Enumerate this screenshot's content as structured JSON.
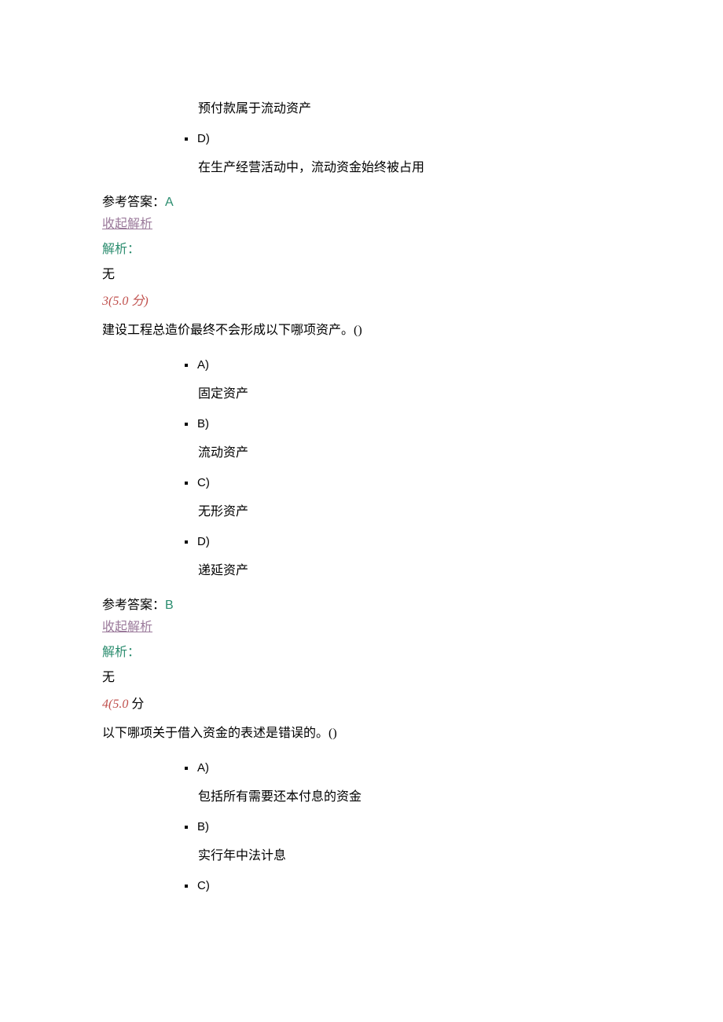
{
  "q2_tail": {
    "optC_text": "预付款属于流动资产",
    "optD_label": "D)",
    "optD_text": "在生产经营活动中，流动资金始终被占用",
    "answer_label": "参考答案：",
    "answer_value": "A",
    "collapse": "收起解析",
    "analysis_label": "解析：",
    "analysis_body": "无"
  },
  "q3": {
    "number": "3(5.0",
    "points_suffix": " 分)",
    "stem": "建设工程总造价最终不会形成以下哪项资产。()",
    "optA_label": "A)",
    "optA_text": "固定资产",
    "optB_label": "B)",
    "optB_text": "流动资产",
    "optC_label": "C)",
    "optC_text": "无形资产",
    "optD_label": "D)",
    "optD_text": "递延资产",
    "answer_label": "参考答案：",
    "answer_value": "B",
    "collapse": "收起解析",
    "analysis_label": "解析：",
    "analysis_body": "无"
  },
  "q4": {
    "number": "4(5.0",
    "points_suffix": " 分",
    "stem": "以下哪项关于借入资金的表述是错误的。()",
    "optA_label": "A)",
    "optA_text": "包括所有需要还本付息的资金",
    "optB_label": "B)",
    "optB_text": "实行年中法计息",
    "optC_label": "C)"
  }
}
